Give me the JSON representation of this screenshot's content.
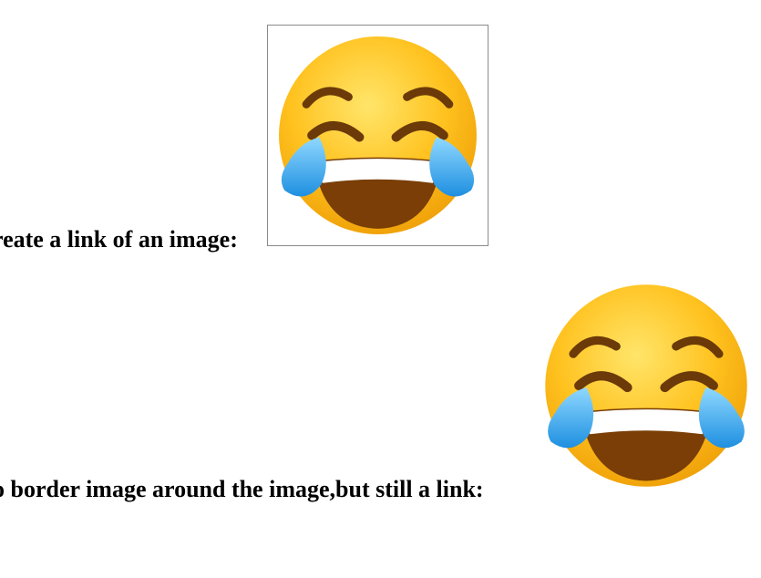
{
  "section_one": {
    "heading": "reate a link of an image:",
    "image_icon": "face-with-tears-of-joy-icon",
    "border_color": "#8a8a8a"
  },
  "section_two": {
    "heading": "o border image around the image,but still a link:",
    "image_icon": "face-with-tears-of-joy-icon"
  },
  "colors": {
    "face_light": "#ffd93b",
    "face_dark": "#f0a30a",
    "mouth": "#7a3e06",
    "teeth": "#ffffff",
    "tear": "#37a6f0"
  }
}
